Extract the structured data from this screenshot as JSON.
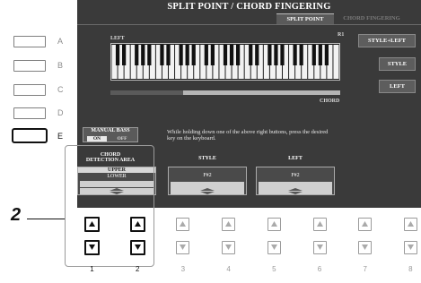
{
  "panel_buttons": [
    {
      "letter": "A"
    },
    {
      "letter": "B"
    },
    {
      "letter": "C"
    },
    {
      "letter": "D"
    },
    {
      "letter": "E"
    }
  ],
  "screen": {
    "title": "SPLIT POINT / CHORD FINGERING",
    "tabs": [
      "SPLIT POINT",
      "CHORD FINGERING"
    ],
    "active_tab": 0,
    "keyboard_left_label": "LEFT",
    "keyboard_right_label": "R1",
    "chord_label": "CHORD",
    "right_buttons": [
      "STYLE+LEFT",
      "STYLE",
      "LEFT"
    ],
    "manual_bass": {
      "title": "MANUAL BASS",
      "on": "ON",
      "off": "OFF",
      "selected": "ON"
    },
    "instruction": "While holding down one of the above right buttons, press the desired key on the keyboard.",
    "chord_detection": {
      "header_line1": "CHORD",
      "header_line2": "DETECTION AREA",
      "options": [
        "UPPER",
        "LOWER"
      ],
      "selected": "UPPER"
    },
    "style": {
      "header": "STYLE",
      "value": "F#2"
    },
    "left": {
      "header": "LEFT",
      "value": "F#2"
    }
  },
  "step": {
    "number": "2"
  },
  "bottom_buttons": [
    "1",
    "2",
    "3",
    "4",
    "5",
    "6",
    "7",
    "8"
  ],
  "colors": {
    "screen_bg": "#3a3a3a",
    "highlight": "#d7d7d7"
  }
}
